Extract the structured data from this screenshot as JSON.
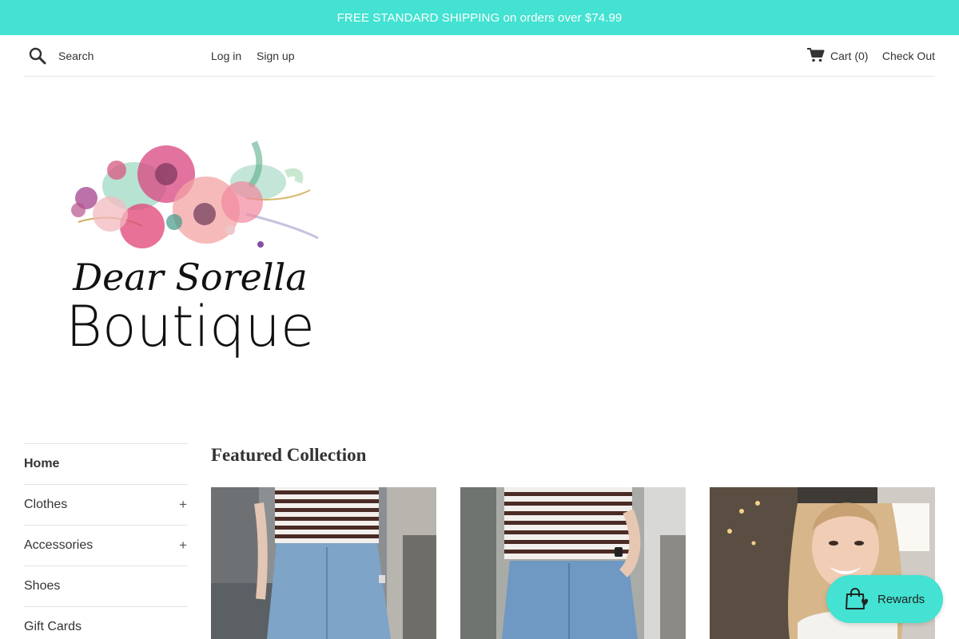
{
  "announcement": {
    "text": "FREE STANDARD SHIPPING on orders over $74.99"
  },
  "header": {
    "search_placeholder": "Search",
    "login_label": "Log in",
    "signup_label": "Sign up",
    "cart_label": "Cart (0)",
    "checkout_label": "Check Out"
  },
  "brand": {
    "logo_line1": "Dear Sorella",
    "logo_line2": "Boutique"
  },
  "sidebar": {
    "items": [
      {
        "label": "Home",
        "expandable": false
      },
      {
        "label": "Clothes",
        "expandable": true,
        "toggle": "+"
      },
      {
        "label": "Accessories",
        "expandable": true,
        "toggle": "+"
      },
      {
        "label": "Shoes",
        "expandable": false
      },
      {
        "label": "Gift Cards",
        "expandable": false
      }
    ]
  },
  "main": {
    "section_title": "Featured Collection",
    "products": [
      {
        "image_icon": "striped-top-jeans-photo"
      },
      {
        "image_icon": "striped-top-jeans-photo"
      },
      {
        "image_icon": "smiling-woman-white-top-photo"
      }
    ]
  },
  "rewards": {
    "label": "Rewards",
    "icon": "shopping-bag-heart-icon"
  },
  "colors": {
    "accent": "#43e2d2",
    "text": "#333333",
    "divider": "#e4e4e4"
  }
}
